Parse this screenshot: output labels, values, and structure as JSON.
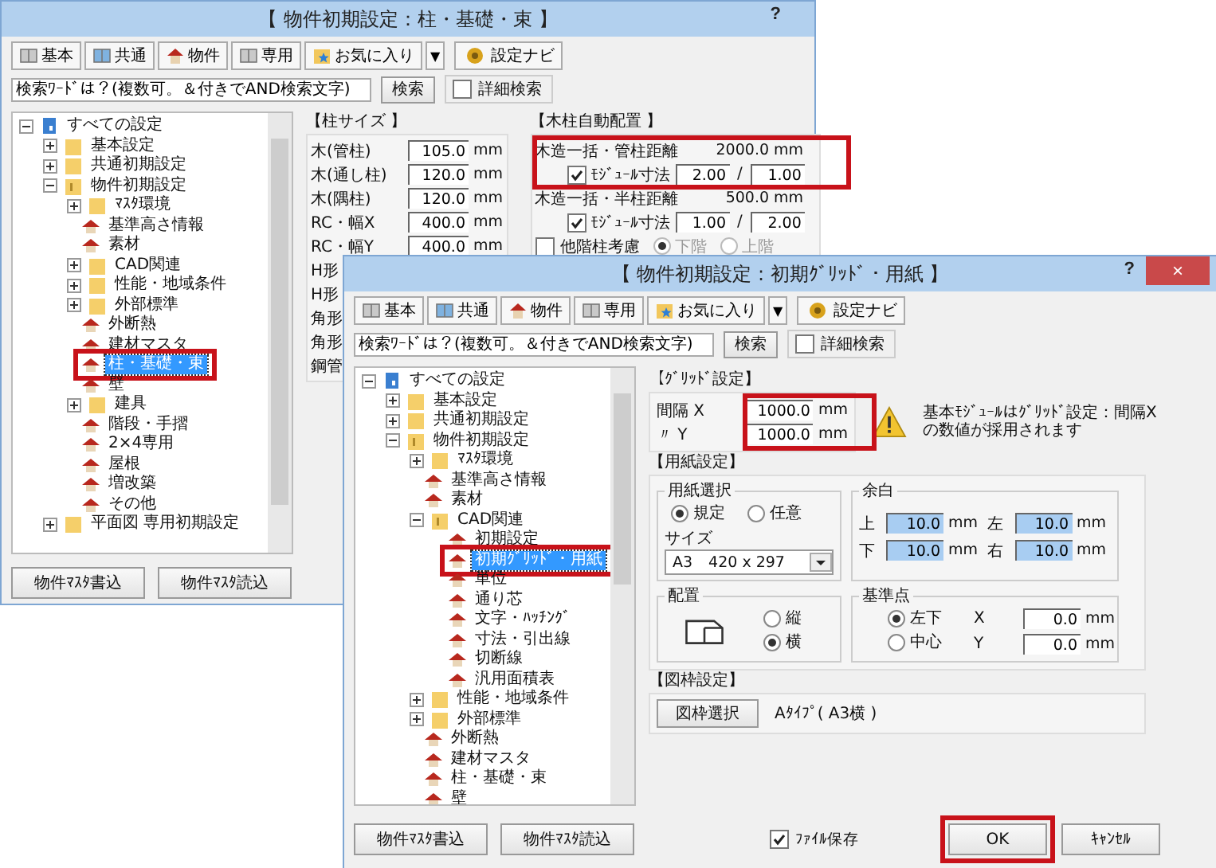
{
  "windows": [
    {
      "kind": "column",
      "title": "【 物件初期設定：柱・基礎・束 】",
      "help": "?",
      "toolbar": [
        {
          "label": "基本"
        },
        {
          "label": "共通"
        },
        {
          "label": "物件"
        },
        {
          "label": "専用"
        },
        {
          "label": "お気に入り"
        },
        {
          "label": "▼"
        },
        {
          "label": "設定ナビ"
        }
      ],
      "search": {
        "value": "検索ﾜｰﾄﾞは？(複数可。＆付きでAND検索文字)",
        "button": "検索",
        "detail": {
          "label": "詳細検索",
          "checked": false
        }
      },
      "tree": [
        {
          "label": "すべての設定",
          "kind": "root",
          "expanded": true,
          "selected": false,
          "children": [
            {
              "label": "基本設定",
              "kind": "folder",
              "expanded": false,
              "selected": false
            },
            {
              "label": "共通初期設定",
              "kind": "folder",
              "expanded": false,
              "selected": false
            },
            {
              "label": "物件初期設定",
              "kind": "folder",
              "expanded": true,
              "selected": false,
              "children": [
                {
                  "label": "ﾏｽﾀ環境",
                  "kind": "folder",
                  "expanded": false,
                  "selected": false
                },
                {
                  "label": "基準高さ情報",
                  "kind": "page",
                  "selected": false
                },
                {
                  "label": "素材",
                  "kind": "page",
                  "selected": false
                },
                {
                  "label": "CAD関連",
                  "kind": "folder",
                  "expanded": false,
                  "selected": false
                },
                {
                  "label": "性能・地域条件",
                  "kind": "folder",
                  "expanded": false,
                  "selected": false
                },
                {
                  "label": "外部標準",
                  "kind": "folder",
                  "expanded": false,
                  "selected": false
                },
                {
                  "label": "外断熱",
                  "kind": "page",
                  "selected": false
                },
                {
                  "label": "建材マスタ",
                  "kind": "page",
                  "selected": false
                },
                {
                  "label": "柱・基礎・束",
                  "kind": "page",
                  "selected": true,
                  "callout": true
                },
                {
                  "label": "壁",
                  "kind": "page",
                  "selected": false
                },
                {
                  "label": "建具",
                  "kind": "folder",
                  "expanded": false,
                  "selected": false
                },
                {
                  "label": "階段・手摺",
                  "kind": "page",
                  "selected": false
                },
                {
                  "label": "2×4専用",
                  "kind": "page",
                  "selected": false
                },
                {
                  "label": "屋根",
                  "kind": "page",
                  "selected": false
                },
                {
                  "label": "増改築",
                  "kind": "page",
                  "selected": false
                },
                {
                  "label": "その他",
                  "kind": "page",
                  "selected": false
                }
              ]
            },
            {
              "label": "平面図 専用初期設定",
              "kind": "folder",
              "expanded": false,
              "selected": false
            }
          ]
        }
      ],
      "buttons": [
        "物件ﾏｽﾀ書込",
        "物件ﾏｽﾀ読込"
      ],
      "size_group": {
        "heading": "【柱サイズ 】",
        "rows": [
          {
            "label": "木(管柱)",
            "value": "105.0",
            "unit": "mm"
          },
          {
            "label": "木(通し柱)",
            "value": "120.0",
            "unit": "mm"
          },
          {
            "label": "木(隅柱)",
            "value": "120.0",
            "unit": "mm"
          },
          {
            "label": "RC・幅X",
            "value": "400.0",
            "unit": "mm"
          },
          {
            "label": "RC・幅Y",
            "value": "400.0",
            "unit": "mm"
          },
          {
            "label": "H形"
          },
          {
            "label": "H形"
          },
          {
            "label": "角形"
          },
          {
            "label": "角形"
          },
          {
            "label": "鋼管"
          }
        ]
      },
      "auto_group": {
        "heading": "【木柱自動配置 】",
        "blocks": [
          {
            "callout": true,
            "label": "木造一括・管柱距離",
            "value": "2000.0",
            "unit": "mm",
            "module": {
              "checked": true,
              "label": "ﾓｼﾞｭｰﾙ寸法",
              "value_a": "2.00",
              "separator": "/",
              "value_b": "1.00"
            }
          },
          {
            "label": "木造一括・半柱距離",
            "value": "500.0",
            "unit": "mm",
            "module": {
              "checked": true,
              "label": "ﾓｼﾞｭｰﾙ寸法",
              "value_a": "1.00",
              "separator": "/",
              "value_b": "2.00"
            }
          }
        ],
        "other_floor": {
          "checked": false,
          "label": "他階柱考慮",
          "disabled": true,
          "options": [
            {
              "label": "下階",
              "selected": true
            },
            {
              "label": "上階",
              "selected": false
            }
          ]
        }
      }
    },
    {
      "kind": "grid",
      "title": "【 物件初期設定 : 初期ｸﾞﾘｯﾄﾞ・用紙 】",
      "help": "?",
      "close": "×",
      "toolbar": [
        {
          "label": "基本"
        },
        {
          "label": "共通"
        },
        {
          "label": "物件"
        },
        {
          "label": "専用"
        },
        {
          "label": "お気に入り"
        },
        {
          "label": "▼"
        },
        {
          "label": "設定ナビ"
        }
      ],
      "search": {
        "value": "検索ﾜｰﾄﾞは？(複数可。＆付きでAND検索文字)",
        "button": "検索",
        "detail": {
          "label": "詳細検索",
          "checked": false
        }
      },
      "tree": [
        {
          "label": "すべての設定",
          "kind": "root",
          "expanded": true,
          "selected": false,
          "children": [
            {
              "label": "基本設定",
              "kind": "folder",
              "expanded": false,
              "selected": false
            },
            {
              "label": "共通初期設定",
              "kind": "folder",
              "expanded": false,
              "selected": false
            },
            {
              "label": "物件初期設定",
              "kind": "folder",
              "expanded": true,
              "selected": false,
              "children": [
                {
                  "label": "ﾏｽﾀ環境",
                  "kind": "folder",
                  "expanded": false,
                  "selected": false
                },
                {
                  "label": "基準高さ情報",
                  "kind": "page",
                  "selected": false
                },
                {
                  "label": "素材",
                  "kind": "page",
                  "selected": false
                },
                {
                  "label": "CAD関連",
                  "kind": "folder",
                  "expanded": true,
                  "selected": false,
                  "children": [
                    {
                      "label": "初期設定",
                      "kind": "page",
                      "selected": false
                    },
                    {
                      "label": "初期ｸﾞﾘｯﾄﾞ・用紙",
                      "kind": "page",
                      "selected": true,
                      "callout": true
                    },
                    {
                      "label": "単位",
                      "kind": "page",
                      "selected": false
                    },
                    {
                      "label": "通り芯",
                      "kind": "page",
                      "selected": false
                    },
                    {
                      "label": "文字・ﾊｯﾁﾝｸﾞ",
                      "kind": "page",
                      "selected": false
                    },
                    {
                      "label": "寸法・引出線",
                      "kind": "page",
                      "selected": false
                    },
                    {
                      "label": "切断線",
                      "kind": "page",
                      "selected": false
                    },
                    {
                      "label": "汎用面積表",
                      "kind": "page",
                      "selected": false
                    }
                  ]
                },
                {
                  "label": "性能・地域条件",
                  "kind": "folder",
                  "expanded": false,
                  "selected": false
                },
                {
                  "label": "外部標準",
                  "kind": "folder",
                  "expanded": false,
                  "selected": false
                },
                {
                  "label": "外断熱",
                  "kind": "page",
                  "selected": false
                },
                {
                  "label": "建材マスタ",
                  "kind": "page",
                  "selected": false
                },
                {
                  "label": "柱・基礎・束",
                  "kind": "page",
                  "selected": false
                },
                {
                  "label": "壁",
                  "kind": "page",
                  "selected": false
                }
              ]
            }
          ]
        }
      ],
      "buttons": [
        "物件ﾏｽﾀ書込",
        "物件ﾏｽﾀ読込"
      ],
      "grid_group": {
        "heading": "【ｸﾞﾘｯﾄﾞ設定】",
        "callout": true,
        "rows": [
          {
            "label": "間隔 X",
            "value": "1000.0",
            "unit": "mm"
          },
          {
            "label": "〃 Y",
            "value": "1000.0",
            "unit": "mm"
          }
        ],
        "notice": "基本ﾓｼﾞｭｰﾙはｸﾞﾘｯﾄﾞ設定：間隔Xの数値が採用されます"
      },
      "paper_group": {
        "heading": "【用紙設定】",
        "paper_select": {
          "title": "用紙選択",
          "options": [
            {
              "label": "規定",
              "selected": true
            },
            {
              "label": "任意",
              "selected": false
            }
          ],
          "size_label": "サイズ",
          "size": "A3　420 x 297"
        },
        "margin": {
          "title": "余白",
          "fields": [
            {
              "label": "上",
              "value": "10.0",
              "unit": "mm",
              "highlighted": true
            },
            {
              "label": "左",
              "value": "10.0",
              "unit": "mm",
              "highlighted": true
            },
            {
              "label": "下",
              "value": "10.0",
              "unit": "mm",
              "highlighted": true
            },
            {
              "label": "右",
              "value": "10.0",
              "unit": "mm",
              "highlighted": true
            }
          ]
        },
        "layout": {
          "title": "配置",
          "options": [
            {
              "label": "縦",
              "selected": false
            },
            {
              "label": "横",
              "selected": true
            }
          ]
        },
        "origin": {
          "title": "基準点",
          "options": [
            {
              "label": "左下",
              "selected": true
            },
            {
              "label": "中心",
              "selected": false
            }
          ],
          "fields": [
            {
              "label": "X",
              "value": "0.0",
              "unit": "mm",
              "highlighted": false
            },
            {
              "label": "Y",
              "value": "0.0",
              "unit": "mm",
              "highlighted": false
            }
          ]
        }
      },
      "frame_group": {
        "heading": "【図枠設定】",
        "button": "図枠選択",
        "value": "Aﾀｲﾌﾟ( A3横 )"
      },
      "footer": {
        "save": {
          "label": "ﾌｧｲﾙ保存",
          "checked": true
        },
        "ok": {
          "label": "OK",
          "callout": true
        },
        "cancel": "ｷｬﾝｾﾙ"
      }
    }
  ]
}
